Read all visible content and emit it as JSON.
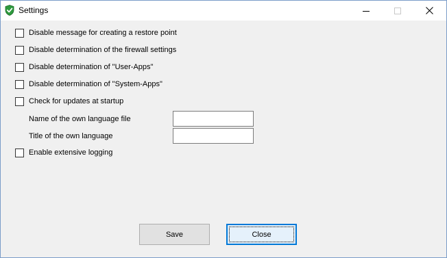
{
  "window": {
    "title": "Settings",
    "icon": "shield-check-icon",
    "controls": [
      "minimize-icon",
      "maximize-icon",
      "close-icon"
    ]
  },
  "options": {
    "disable_restore_point_msg": {
      "label": "Disable message for creating a restore point",
      "checked": false
    },
    "disable_firewall": {
      "label": "Disable determination of the firewall settings",
      "checked": false
    },
    "disable_user_apps": {
      "label": "Disable determination of \"User-Apps\"",
      "checked": false
    },
    "disable_system_apps": {
      "label": "Disable determination of \"System-Apps\"",
      "checked": false
    },
    "check_updates": {
      "label": "Check for updates at startup",
      "checked": false
    },
    "extensive_logging": {
      "label": "Enable extensive logging",
      "checked": false
    }
  },
  "fields": {
    "language_file": {
      "label": "Name of the own language file",
      "value": ""
    },
    "language_title": {
      "label": "Title of the own language",
      "value": ""
    }
  },
  "buttons": {
    "save": "Save",
    "close": "Close"
  },
  "colors": {
    "window_bg": "#f0f0f0",
    "titlebar_bg": "#ffffff",
    "focus_border": "#0078d7",
    "icon_green": "#2e9a3e"
  }
}
